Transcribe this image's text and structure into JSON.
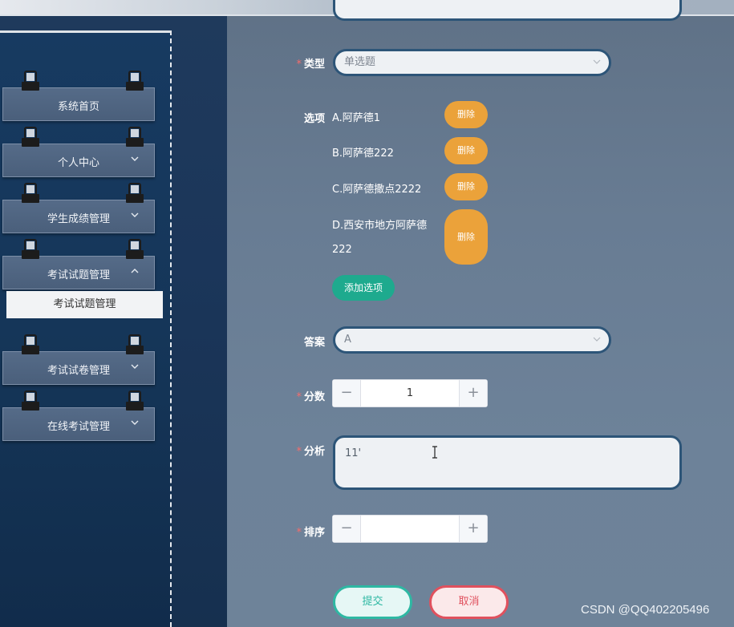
{
  "sidebar": {
    "items": [
      {
        "label": "系统首页",
        "chevron": ""
      },
      {
        "label": "个人中心",
        "chevron": "down"
      },
      {
        "label": "学生成绩管理",
        "chevron": "down"
      },
      {
        "label": "考试试题管理",
        "chevron": "up"
      },
      {
        "label": "考试试卷管理",
        "chevron": "down"
      },
      {
        "label": "在线考试管理",
        "chevron": "down"
      }
    ],
    "submenu": {
      "label": "考试试题管理"
    }
  },
  "form": {
    "type": {
      "label": "类型",
      "required": true,
      "value": "单选题"
    },
    "options": {
      "label": "选项",
      "items": [
        {
          "text": "A.阿萨德1",
          "delete_label": "删除"
        },
        {
          "text": "B.阿萨德222",
          "delete_label": "删除"
        },
        {
          "text": "C.阿萨德撒点2222",
          "delete_label": "删除"
        },
        {
          "text_line1": "D.西安市地方阿萨德",
          "text_line2": "222",
          "delete_label": "删除"
        }
      ],
      "add_label": "添加选项"
    },
    "answer": {
      "label": "答案",
      "required": false,
      "value": "A"
    },
    "score": {
      "label": "分数",
      "required": true,
      "value": "1",
      "minus": "−",
      "plus": "+"
    },
    "analysis": {
      "label": "分析",
      "required": true,
      "value": "11'"
    },
    "order": {
      "label": "排序",
      "required": true,
      "value": "",
      "minus": "−",
      "plus": "+"
    },
    "submit_label": "提交",
    "cancel_label": "取消"
  },
  "watermark": "CSDN @QQ402205496",
  "colors": {
    "delete": "#eba23a",
    "add": "#1eaa8e",
    "submit": "#2eb8a3",
    "cancel": "#e0515e",
    "required_star": "#f56c6c"
  },
  "icons": {
    "clip": "binder-clip-icon",
    "chevron_down": "chevron-down-icon",
    "chevron_up": "chevron-up-icon",
    "select_arrow": "chevron-down-icon"
  }
}
